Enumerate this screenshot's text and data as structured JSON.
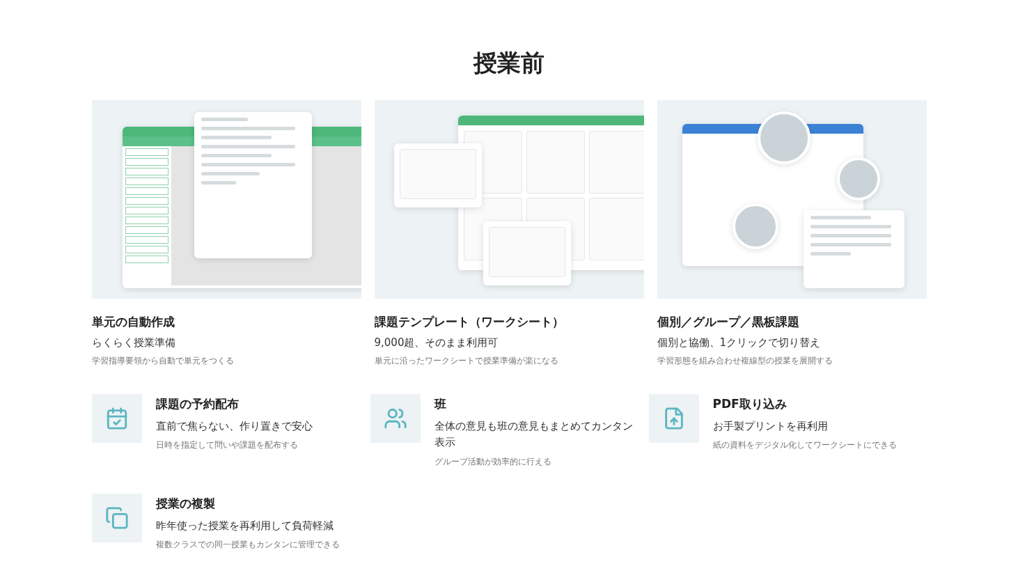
{
  "section": {
    "title": "授業前"
  },
  "cards": [
    {
      "kind": "unit-form",
      "title": "単元の自動作成",
      "subtitle": "らくらく授業準備",
      "caption": "学習指導要領から自動で単元をつくる"
    },
    {
      "kind": "worksheet-grid",
      "title": "課題テンプレート（ワークシート）",
      "subtitle": "9,000超、そのまま利用可",
      "caption": "単元に沿ったワークシートで授業準備が楽になる"
    },
    {
      "kind": "group-board",
      "title": "個別／グループ／黒板課題",
      "subtitle": "個別と協働、1クリックで切り替え",
      "caption": "学習形態を組み合わせ複線型の授業を展開する"
    }
  ],
  "features": [
    {
      "kind": "calendar",
      "title": "課題の予約配布",
      "subtitle": "直前で焦らない、作り置きで安心",
      "caption": "日時を指定して問いや課題を配布する"
    },
    {
      "kind": "users",
      "title": "班",
      "subtitle": "全体の意見も班の意見もまとめてカンタン表示",
      "caption": "グループ活動が効率的に行える"
    },
    {
      "kind": "pdf",
      "title": "PDF取り込み",
      "subtitle": "お手製プリントを再利用",
      "caption": "紙の資料をデジタル化してワークシートにできる"
    },
    {
      "kind": "copy",
      "title": "授業の複製",
      "subtitle": "昨年使った授業を再利用して負荷軽減",
      "caption": "複数クラスでの同一授業もカンタンに管理できる"
    }
  ]
}
